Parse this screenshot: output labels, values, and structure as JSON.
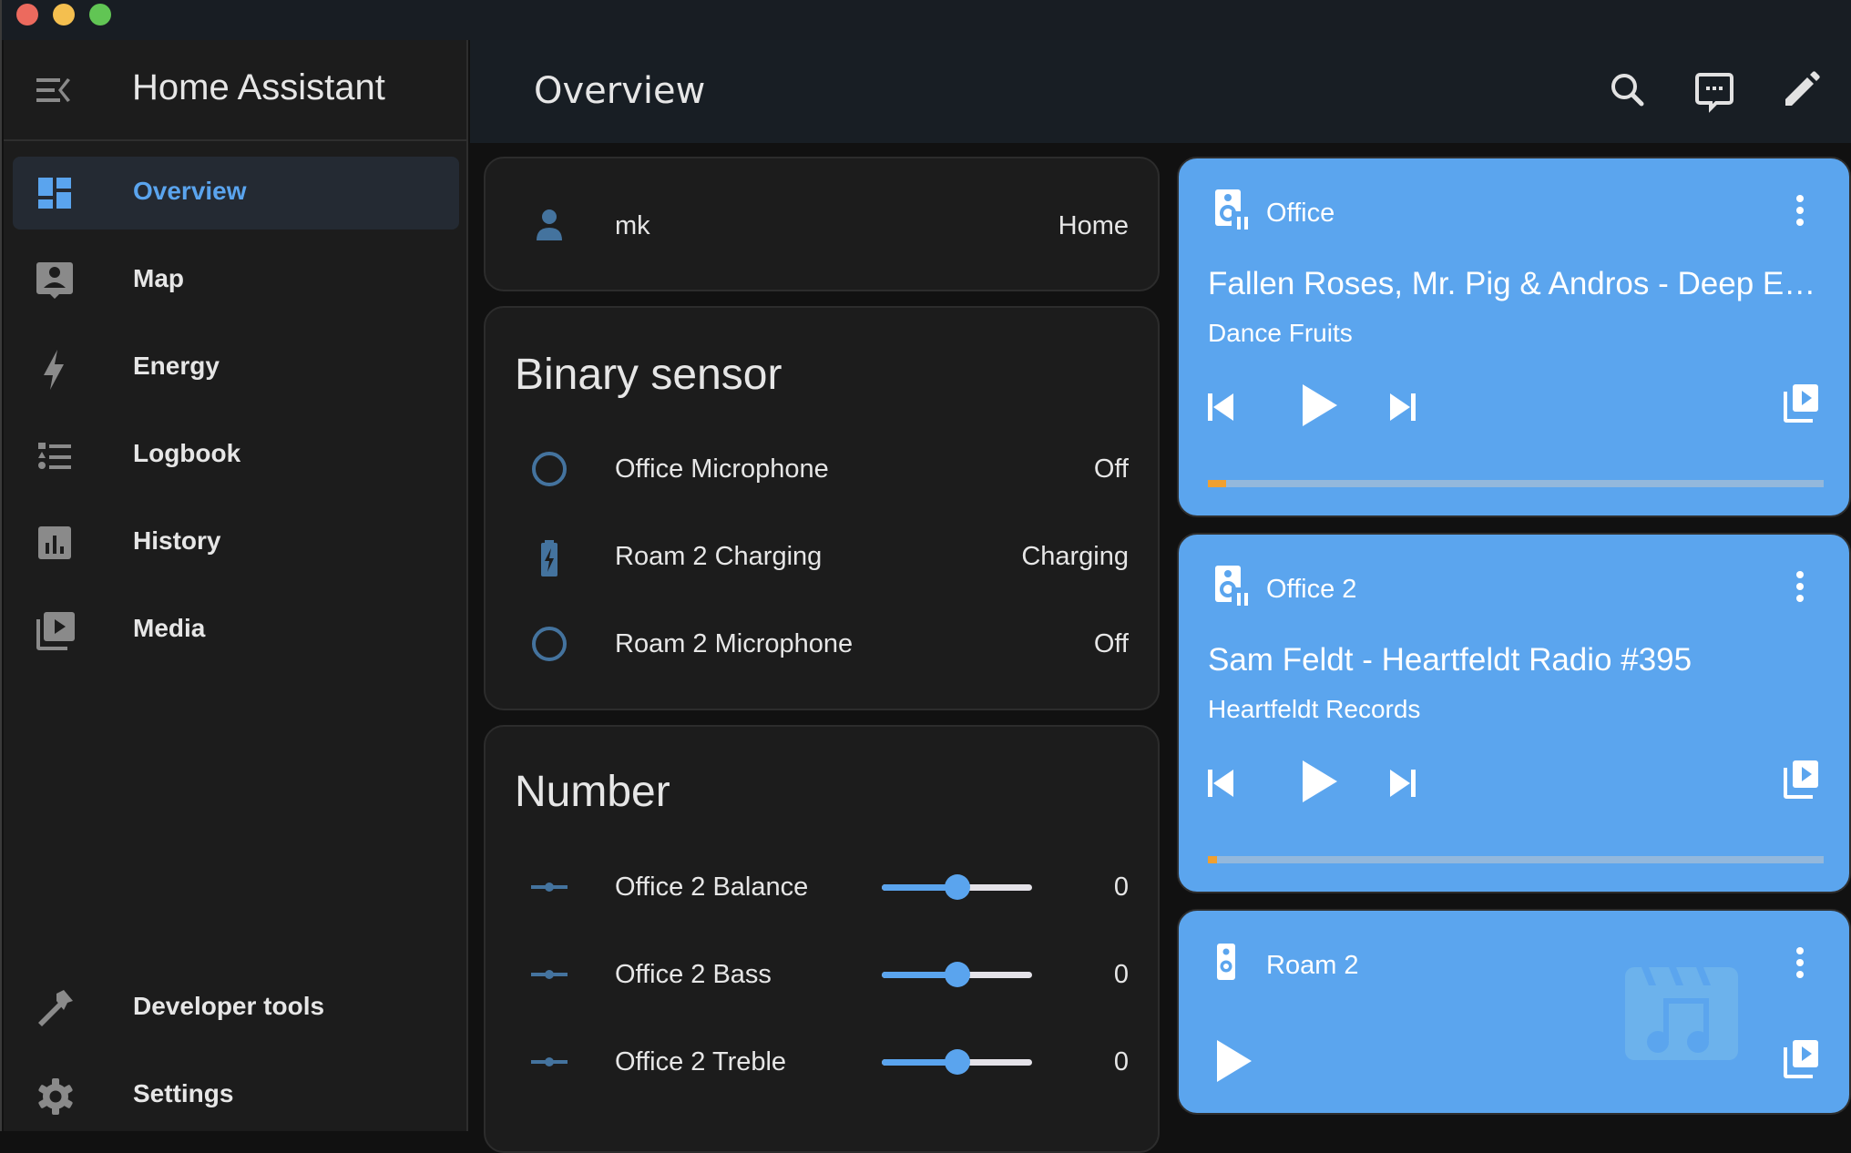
{
  "window": {
    "traffic_lights": [
      "close",
      "minimize",
      "maximize"
    ]
  },
  "sidebar": {
    "title": "Home Assistant",
    "menu_icon": "menu-open-icon",
    "items": [
      {
        "label": "Overview",
        "icon": "view-dashboard-icon",
        "active": true
      },
      {
        "label": "Map",
        "icon": "account-box-marker-icon",
        "active": false
      },
      {
        "label": "Energy",
        "icon": "lightning-bolt-icon",
        "active": false
      },
      {
        "label": "Logbook",
        "icon": "format-list-bulleted-type-icon",
        "active": false
      },
      {
        "label": "History",
        "icon": "chart-box-icon",
        "active": false
      },
      {
        "label": "Media",
        "icon": "play-box-multiple-icon",
        "active": false
      }
    ],
    "bottom_items": [
      {
        "label": "Developer tools",
        "icon": "hammer-icon"
      },
      {
        "label": "Settings",
        "icon": "cog-icon"
      }
    ]
  },
  "header": {
    "title": "Overview",
    "actions": [
      {
        "name": "search",
        "icon": "magnify-icon"
      },
      {
        "name": "assist",
        "icon": "comment-processing-outline-icon"
      },
      {
        "name": "edit",
        "icon": "pencil-icon"
      }
    ]
  },
  "colors": {
    "accent": "#5aa4ee",
    "media_card_bg": "#5ba5ee",
    "progress_fill": "#f0a030",
    "state_icon": "#44739e"
  },
  "person_card": {
    "name": "mk",
    "state": "Home",
    "icon": "account-icon"
  },
  "binary_sensor_card": {
    "title": "Binary sensor",
    "rows": [
      {
        "label": "Office Microphone",
        "value": "Off",
        "icon": "checkbox-blank-circle-outline-icon"
      },
      {
        "label": "Roam 2 Charging",
        "value": "Charging",
        "icon": "battery-charging-icon"
      },
      {
        "label": "Roam 2 Microphone",
        "value": "Off",
        "icon": "checkbox-blank-circle-outline-icon"
      }
    ]
  },
  "number_card": {
    "title": "Number",
    "rows": [
      {
        "label": "Office 2 Balance",
        "value": "0",
        "slider_fraction": 0.5,
        "icon": "ray-vertex-icon"
      },
      {
        "label": "Office 2 Bass",
        "value": "0",
        "slider_fraction": 0.5,
        "icon": "ray-vertex-icon"
      },
      {
        "label": "Office 2 Treble",
        "value": "0",
        "slider_fraction": 0.5,
        "icon": "ray-vertex-icon"
      }
    ]
  },
  "media_cards": [
    {
      "name": "Office",
      "icon": "speaker-pause-icon",
      "title": "Fallen Roses, Mr. Pig & Andros - Deep End (feat. ...",
      "subtitle": "Dance Fruits",
      "controls": [
        "skip-previous-icon",
        "play-icon",
        "skip-next-icon"
      ],
      "browse_icon": "play-box-multiple-icon",
      "progress_percent": 3
    },
    {
      "name": "Office 2",
      "icon": "speaker-pause-icon",
      "title": "Sam Feldt - Heartfeldt Radio #395",
      "subtitle": "Heartfeldt Records",
      "controls": [
        "skip-previous-icon",
        "play-icon",
        "skip-next-icon"
      ],
      "browse_icon": "play-box-multiple-icon",
      "progress_percent": 1.5
    },
    {
      "name": "Roam 2",
      "icon": "speaker-icon",
      "title": "",
      "subtitle": "",
      "controls": [
        "play-icon"
      ],
      "browse_icon": "play-box-multiple-icon",
      "placeholder_art": "movie-open-music-icon"
    }
  ]
}
